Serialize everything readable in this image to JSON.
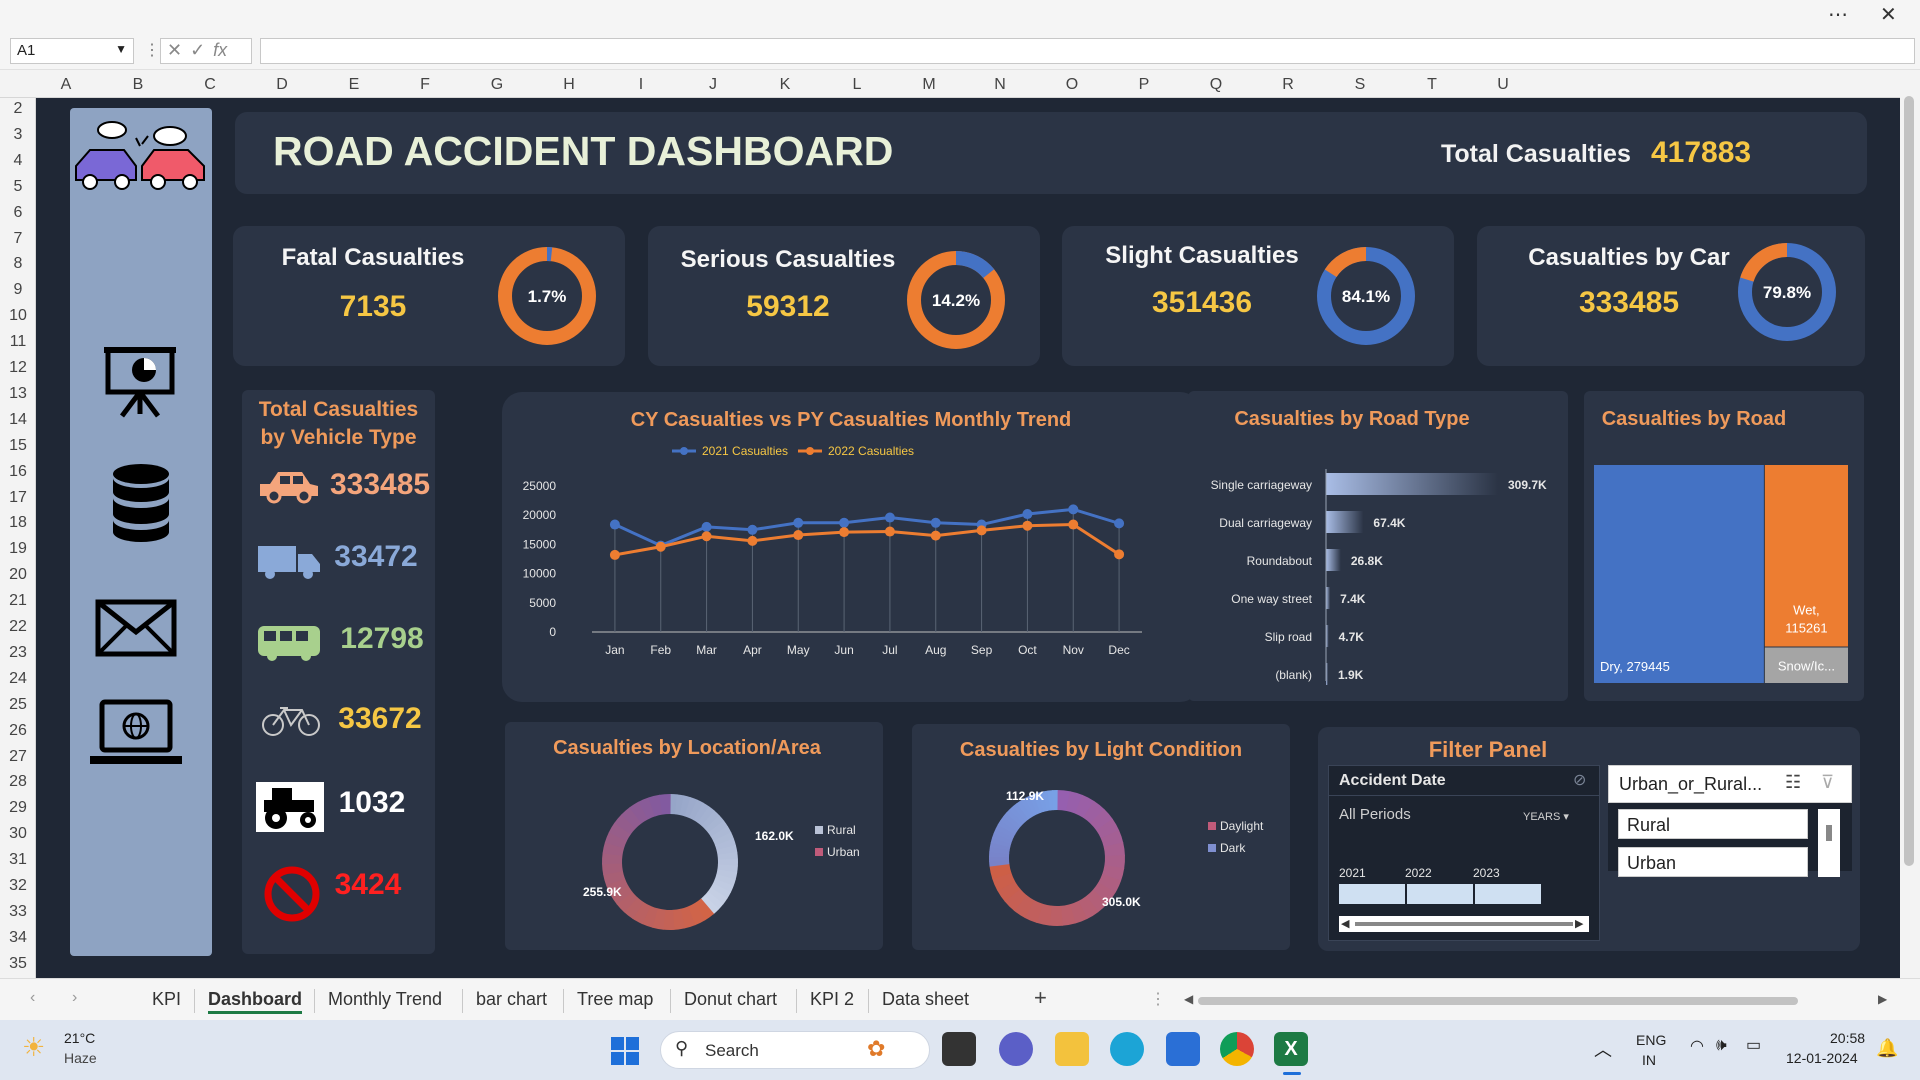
{
  "excel": {
    "name_box": "A1",
    "fx_label": "fx",
    "columns": [
      "A",
      "B",
      "C",
      "D",
      "E",
      "F",
      "G",
      "H",
      "I",
      "J",
      "K",
      "L",
      "M",
      "N",
      "O",
      "P",
      "Q",
      "R",
      "S",
      "T",
      "U"
    ],
    "rows": [
      "2",
      "3",
      "4",
      "5",
      "6",
      "7",
      "8",
      "9",
      "10",
      "11",
      "12",
      "13",
      "14",
      "15",
      "16",
      "17",
      "18",
      "19",
      "20",
      "21",
      "22",
      "23",
      "24",
      "25",
      "26",
      "27",
      "28",
      "29",
      "30",
      "31",
      "32",
      "33",
      "34",
      "35"
    ],
    "sheet_tabs": [
      "KPI",
      "Dashboard",
      "Monthly Trend",
      "bar chart",
      "Tree map",
      "Donut chart",
      "KPI 2",
      "Data sheet"
    ],
    "active_tab": "Dashboard",
    "add_sheet": "+"
  },
  "dashboard": {
    "title": "ROAD ACCIDENT DASHBOARD",
    "total_label": "Total Casualties",
    "total_value": "417883",
    "kpis": [
      {
        "label": "Fatal Casualties",
        "value": "7135",
        "pct": "1.7%",
        "fraction": 0.017
      },
      {
        "label": "Serious Casualties",
        "value": "59312",
        "pct": "14.2%",
        "fraction": 0.142
      },
      {
        "label": "Slight Casualties",
        "value": "351436",
        "pct": "84.1%",
        "fraction": 0.841
      },
      {
        "label": "Casualties by Car",
        "value": "333485",
        "pct": "79.8%",
        "fraction": 0.798
      }
    ],
    "vehicle_title_1": "Total Casualties",
    "vehicle_title_2": "by Vehicle Type",
    "vehicles": [
      {
        "icon": "car-icon",
        "value": "333485",
        "color": "#f4a57c"
      },
      {
        "icon": "truck-icon",
        "value": "33472",
        "color": "#8aa9d8"
      },
      {
        "icon": "bus-icon",
        "value": "12798",
        "color": "#a8d08d"
      },
      {
        "icon": "bicycle-icon",
        "value": "33672",
        "color": "#f6c744"
      },
      {
        "icon": "tractor-icon",
        "value": "1032",
        "color": "#ffffff"
      },
      {
        "icon": "no-entry-icon",
        "value": "3424",
        "color": "#ff2020"
      }
    ]
  },
  "chart_data": [
    {
      "type": "line",
      "title": "CY Casualties vs PY Casualties Monthly Trend",
      "categories": [
        "Jan",
        "Feb",
        "Mar",
        "Apr",
        "May",
        "Jun",
        "Jul",
        "Aug",
        "Sep",
        "Oct",
        "Nov",
        "Dec"
      ],
      "series": [
        {
          "name": "2021 Casualties",
          "color": "#4472c4",
          "values": [
            18400,
            14800,
            18000,
            17500,
            18700,
            18700,
            19600,
            18700,
            18400,
            20200,
            21000,
            18600
          ]
        },
        {
          "name": "2022 Casualties",
          "color": "#ed7d31",
          "values": [
            13200,
            14600,
            16400,
            15600,
            16600,
            17100,
            17200,
            16500,
            17400,
            18200,
            18400,
            13300
          ]
        }
      ],
      "yticks": [
        "0",
        "5000",
        "10000",
        "15000",
        "20000",
        "25000"
      ],
      "ylim": [
        0,
        25000
      ]
    },
    {
      "type": "bar",
      "title": "Casualties by Road Type",
      "categories": [
        "Single carriageway",
        "Dual carriageway",
        "Roundabout",
        "One way street",
        "Slip road",
        "(blank)"
      ],
      "values": [
        309700,
        67400,
        26800,
        7400,
        4700,
        1900
      ],
      "labels": [
        "309.7K",
        "67.4K",
        "26.8K",
        "7.4K",
        "4.7K",
        "1.9K"
      ]
    },
    {
      "type": "heatmap",
      "title": "Casualties by Road",
      "items": [
        {
          "label": "Dry, 279445",
          "value": 279445,
          "color": "#4472c4"
        },
        {
          "label": "Wet, 115261",
          "label_lines": [
            "Wet,",
            "115261"
          ],
          "value": 115261,
          "color": "#ed7d31"
        },
        {
          "label": "Snow/Ic...",
          "value": 23177,
          "color": "#a5a5a5"
        }
      ]
    },
    {
      "type": "pie",
      "title": "Casualties by Location/Area",
      "series": [
        {
          "name": "Rural",
          "value": 162000,
          "label": "162.0K"
        },
        {
          "name": "Urban",
          "value": 255900,
          "label": "255.9K"
        }
      ]
    },
    {
      "type": "pie",
      "title": "Casualties by Light Condition",
      "series": [
        {
          "name": "Daylight",
          "value": 305000,
          "label": "305.0K"
        },
        {
          "name": "Dark",
          "value": 112900,
          "label": "112.9K"
        }
      ]
    }
  ],
  "filter_panel": {
    "title": "Filter Panel",
    "timeline": {
      "header": "Accident Date",
      "periods": "All Periods",
      "unit": "YEARS",
      "years": [
        "2021",
        "2022",
        "2023"
      ]
    },
    "slicer": {
      "header": "Urban_or_Rural...",
      "items": [
        "Rural",
        "Urban"
      ]
    }
  },
  "taskbar": {
    "weather_temp": "21°C",
    "weather_desc": "Haze",
    "search_placeholder": "Search",
    "lang_1": "ENG",
    "lang_2": "IN",
    "time": "20:58",
    "date": "12-01-2024"
  }
}
